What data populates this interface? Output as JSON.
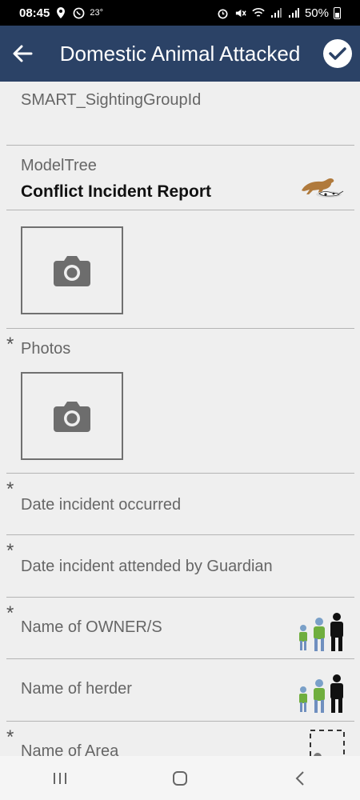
{
  "status_bar": {
    "time": "08:45",
    "temperature": "23°",
    "battery": "50%"
  },
  "header": {
    "title": "Domestic Animal Attacked",
    "back_icon": "arrow-left-icon",
    "done_icon": "check-circle-icon"
  },
  "fields": {
    "sighting_group": {
      "label": "SMART_SightingGroupId"
    },
    "model_tree": {
      "label": "ModelTree",
      "value": "Conflict Incident Report"
    },
    "photos": {
      "label": "Photos",
      "required": "*"
    },
    "date_occurred": {
      "label": "Date incident occurred",
      "required": "*"
    },
    "date_attended": {
      "label": "Date incident attended by Guardian",
      "required": "*"
    },
    "owner_name": {
      "label": "Name of OWNER/S",
      "required": "*"
    },
    "herder_name": {
      "label": "Name of herder"
    },
    "area_name": {
      "label": "Name of Area",
      "required": "*"
    }
  },
  "colors": {
    "appbar": "#2b4266",
    "background": "#efefef"
  }
}
